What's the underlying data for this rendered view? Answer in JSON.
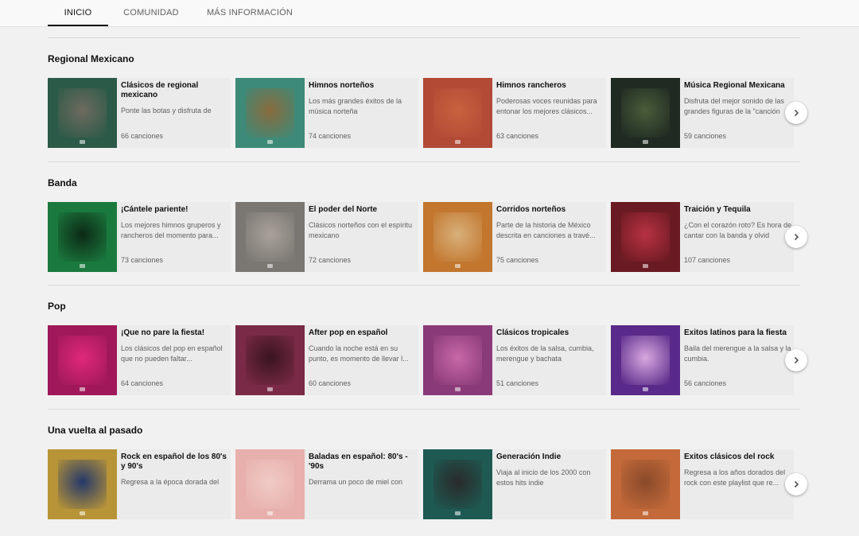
{
  "tabs": [
    {
      "label": "INICIO",
      "active": true
    },
    {
      "label": "COMUNIDAD",
      "active": false
    },
    {
      "label": "MÁS INFORMACIÓN",
      "active": false
    }
  ],
  "sections": [
    {
      "title": "Regional Mexicano",
      "cards": [
        {
          "title": "Clásicos de regional mexicano",
          "desc": "Ponte las botas y disfruta de estos himnos gruperos",
          "count": "66 canciones",
          "bg": "#2c5a48",
          "art": "#6e6a5e"
        },
        {
          "title": "Himnos norteños",
          "desc": "Los más grandes éxitos de la música norteña",
          "count": "74 canciones",
          "bg": "#3e8a78",
          "art": "#8a6a3c"
        },
        {
          "title": "Himnos rancheros",
          "desc": "Poderosas voces reunidas para entonar los mejores clásicos...",
          "count": "63 canciones",
          "bg": "#b24a36",
          "art": "#c8623e"
        },
        {
          "title": "Música Regional Mexicana",
          "desc": "Disfruta del mejor sonido de las grandes figuras de la \"canción",
          "count": "59 canciones",
          "bg": "#1e2a22",
          "art": "#4a5c3a"
        }
      ]
    },
    {
      "title": "Banda",
      "cards": [
        {
          "title": "¡Cántele pariente!",
          "desc": "Los mejores himnos gruperos y rancheros del momento para...",
          "count": "73 canciones",
          "bg": "#1a7a3e",
          "art": "#0d2a16"
        },
        {
          "title": "El poder del Norte",
          "desc": "Clásicos norteños con el espíritu mexicano",
          "count": "72 canciones",
          "bg": "#7a7672",
          "art": "#a8a29a"
        },
        {
          "title": "Corridos norteños",
          "desc": "Parte de la historia de México descrita en canciones a travé...",
          "count": "75 canciones",
          "bg": "#c2762e",
          "art": "#d8b07a"
        },
        {
          "title": "Traición y Tequila",
          "desc": "¿Con el corazón roto? Es hora de cantar con la banda y olvid",
          "count": "107 canciones",
          "bg": "#6a1a22",
          "art": "#b83242"
        }
      ]
    },
    {
      "title": "Pop",
      "cards": [
        {
          "title": "¡Que no pare la fiesta!",
          "desc": "Los clásicos del pop en español que no pueden faltar...",
          "count": "64 canciones",
          "bg": "#a0185a",
          "art": "#e0287a"
        },
        {
          "title": "After pop en español",
          "desc": "Cuando la noche está en su punto, es momento de llevar l...",
          "count": "60 canciones",
          "bg": "#7a2a46",
          "art": "#3a1420"
        },
        {
          "title": "Clásicos tropicales",
          "desc": "Los éxitos de la salsa, cumbia, merengue y bachata",
          "count": "51 canciones",
          "bg": "#8a3a78",
          "art": "#c868a8"
        },
        {
          "title": "Exitos latinos para la fiesta",
          "desc": "Baila del merengue a la salsa y la cumbia.",
          "count": "56 canciones",
          "bg": "#5a2a8a",
          "art": "#d8a8e0"
        }
      ]
    },
    {
      "title": "Una vuelta al pasado",
      "cards": [
        {
          "title": "Rock en español de los 80's y 90's",
          "desc": "Regresa a la época dorada del",
          "count": "",
          "bg": "#b89438",
          "art": "#24386a"
        },
        {
          "title": "Baladas en español: 80's - '90s",
          "desc": "Derrama un poco de miel con",
          "count": "",
          "bg": "#e8b0ac",
          "art": "#f0cac6"
        },
        {
          "title": "Generación Indie",
          "desc": "Viaja al inicio de los 2000 con estos hits indie",
          "count": "",
          "bg": "#1e5a52",
          "art": "#2a2a2a"
        },
        {
          "title": "Exitos clásicos del rock",
          "desc": "Regresa a los años dorados del rock con este playlist que re...",
          "count": "",
          "bg": "#c46a3a",
          "art": "#8a4a2a"
        }
      ]
    }
  ],
  "icons": {
    "next": "chevron-right-icon",
    "youtube": "youtube-logo-icon"
  },
  "colors": {
    "active_tab": "#0f0f0f",
    "muted_text": "#606060",
    "background": "#f1f1f1"
  }
}
